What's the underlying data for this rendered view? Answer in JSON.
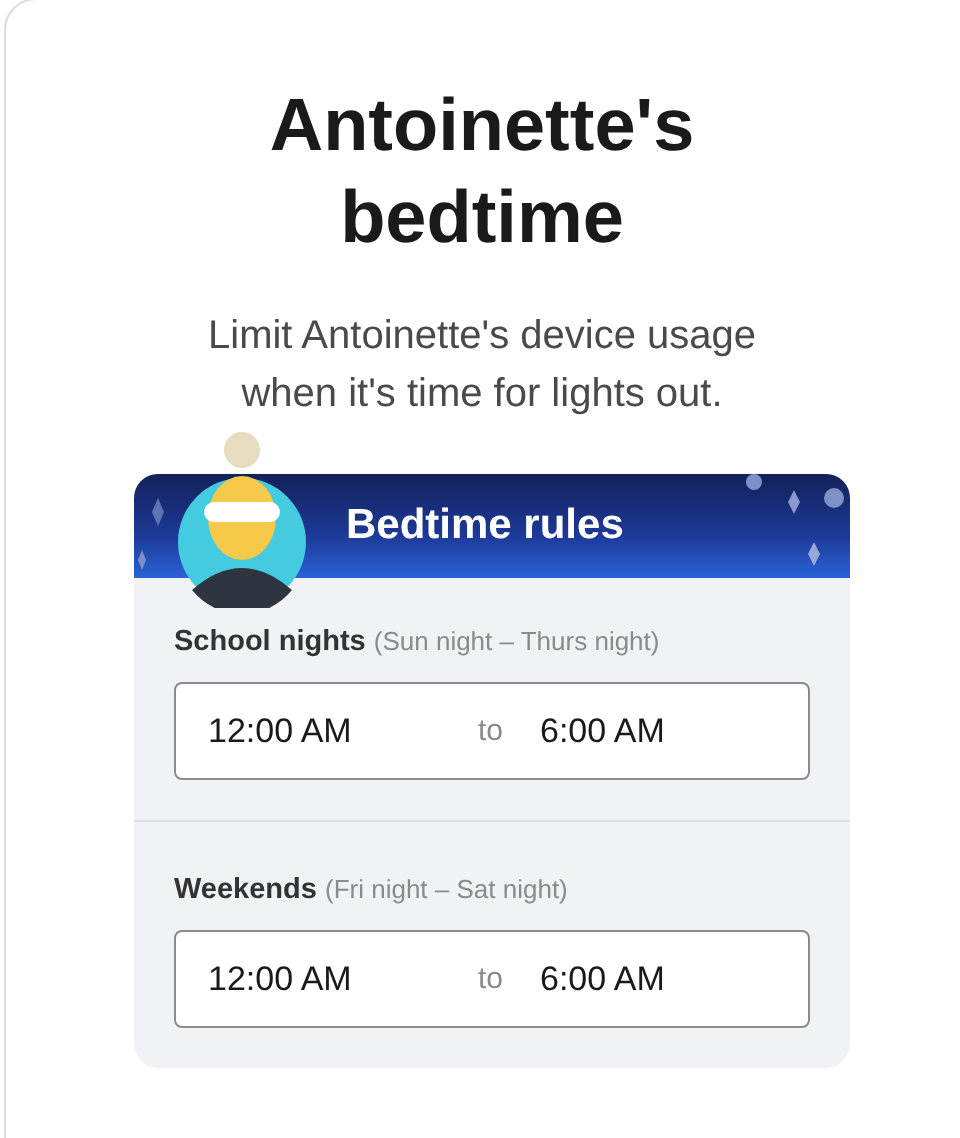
{
  "title": "Antoinette's bedtime",
  "subtitle": "Limit Antoinette's device usage when it's time for lights out.",
  "rules": {
    "title": "Bedtime rules",
    "groups": [
      {
        "label": "School nights",
        "hint": "(Sun night – Thurs night)",
        "start": "12:00 AM",
        "separator": "to",
        "end": "6:00 AM"
      },
      {
        "label": "Weekends",
        "hint": "(Fri night – Sat night)",
        "start": "12:00 AM",
        "separator": "to",
        "end": "6:00 AM"
      }
    ]
  }
}
